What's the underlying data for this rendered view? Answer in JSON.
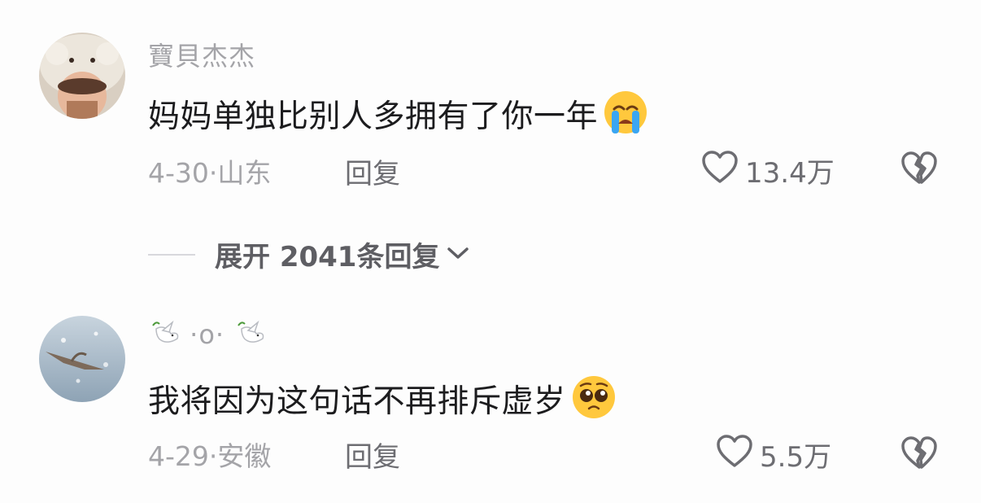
{
  "comments": [
    {
      "username": "寶貝杰杰",
      "text": "妈妈单独比别人多拥有了你一年",
      "emoji": "loudly-crying-face",
      "date": "4-30",
      "separator": "·",
      "location": "山东",
      "reply_label": "回复",
      "likes": "13.4万"
    },
    {
      "username": "·o·",
      "username_icons": "dove-with-olive-branch",
      "text": "我将因为这句话不再排斥虚岁",
      "emoji": "pleading-face",
      "date": "4-29",
      "separator": "·",
      "location": "安徽",
      "reply_label": "回复",
      "likes": "5.5万"
    }
  ],
  "expand_replies": {
    "label": "展开 2041条回复",
    "icon": "chevron-down-icon"
  },
  "colors": {
    "background": "#fdfdfd",
    "primary_text": "#1c1c1e",
    "secondary_text": "#a4a4a8",
    "action_text": "#6d6d72",
    "emoji_yellow": "#ffc83d",
    "tear_blue": "#3aa6f2"
  }
}
